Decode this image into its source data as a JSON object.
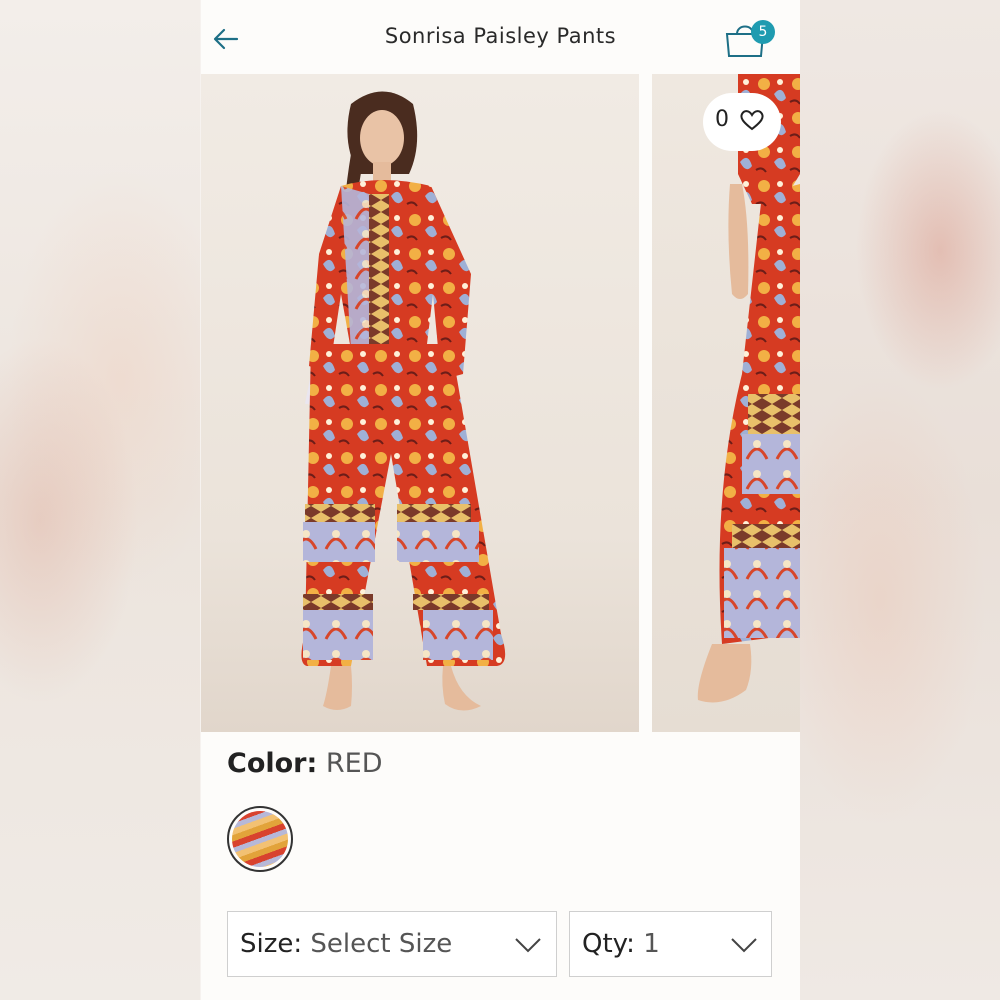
{
  "header": {
    "title": "Sonrisa Paisley Pants",
    "cart_count": "5"
  },
  "gallery": {
    "favorite_count": "0"
  },
  "product": {
    "color_label": "Color:",
    "color_value": "RED"
  },
  "size_select": {
    "label": "Size:",
    "value": "Select Size"
  },
  "qty_select": {
    "label": "Qty:",
    "value": "1"
  },
  "colors": {
    "accent": "#1f9bb0",
    "text": "#222222"
  },
  "icons": [
    "arrow-left-icon",
    "shopping-bag-icon",
    "heart-icon",
    "chevron-down-icon"
  ]
}
